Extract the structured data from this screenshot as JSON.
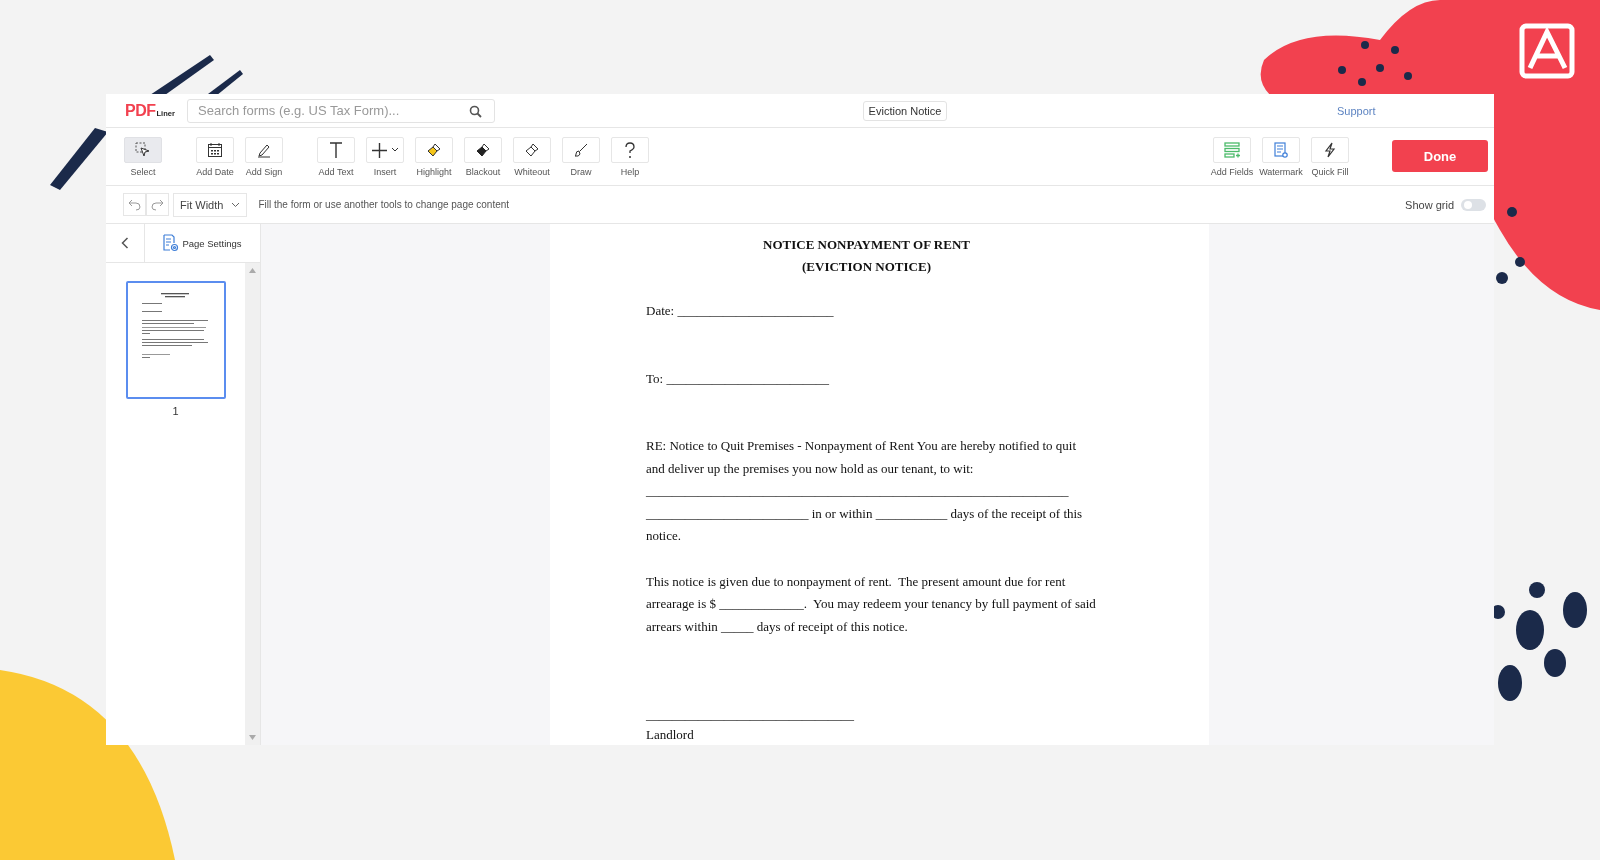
{
  "header": {
    "logo": {
      "mark": "PDF",
      "word": "Liner"
    },
    "search": {
      "placeholder": "Search forms (e.g. US Tax Form)..."
    },
    "document_title": "Eviction Notice",
    "support_link": "Support"
  },
  "toolbar": {
    "left_groups": [
      [
        {
          "label": "Select",
          "selected": true
        }
      ],
      [
        {
          "label": "Add Date",
          "selected": false
        },
        {
          "label": "Add Sign",
          "selected": false
        }
      ],
      [
        {
          "label": "Add Text",
          "selected": false
        },
        {
          "label": "Insert",
          "selected": false
        },
        {
          "label": "Highlight",
          "selected": false
        },
        {
          "label": "Blackout",
          "selected": false
        },
        {
          "label": "Whiteout",
          "selected": false
        },
        {
          "label": "Draw",
          "selected": false
        },
        {
          "label": "Help",
          "selected": false
        }
      ]
    ],
    "right_tools": [
      {
        "label": "Add Fields",
        "selected": false
      },
      {
        "label": "Watermark",
        "selected": false
      },
      {
        "label": "Quick Fill",
        "selected": false
      }
    ],
    "done_button": "Done"
  },
  "subbar": {
    "zoom": "Fit Width",
    "hint": "Fill the form or use another tools to change page content",
    "show_grid": {
      "label": "Show grid",
      "on": false
    }
  },
  "sidebar": {
    "tab": "Page Settings",
    "pages": [
      {
        "number": "1",
        "selected": true
      }
    ]
  },
  "document": {
    "title_lines": [
      "NOTICE NONPAYMENT OF RENT",
      "(EVICTION NOTICE)"
    ],
    "paragraphs": [
      "Date: ________________________",
      "To: _________________________",
      "RE: Notice to Quit Premises - Nonpayment of Rent You are hereby notified to quit and deliver up the premises you now hold as our tenant, to wit:",
      "_________________________________________________________________",
      "_________________________ in or within ___________ days of the receipt of this notice.",
      "This notice is given due to nonpayment of rent.  The present amount due for rent arrearage is $ _____________.  You may redeem your tenancy by full payment of said arrears within _____ days of receipt of this notice.",
      "________________________________",
      "Landlord"
    ]
  }
}
